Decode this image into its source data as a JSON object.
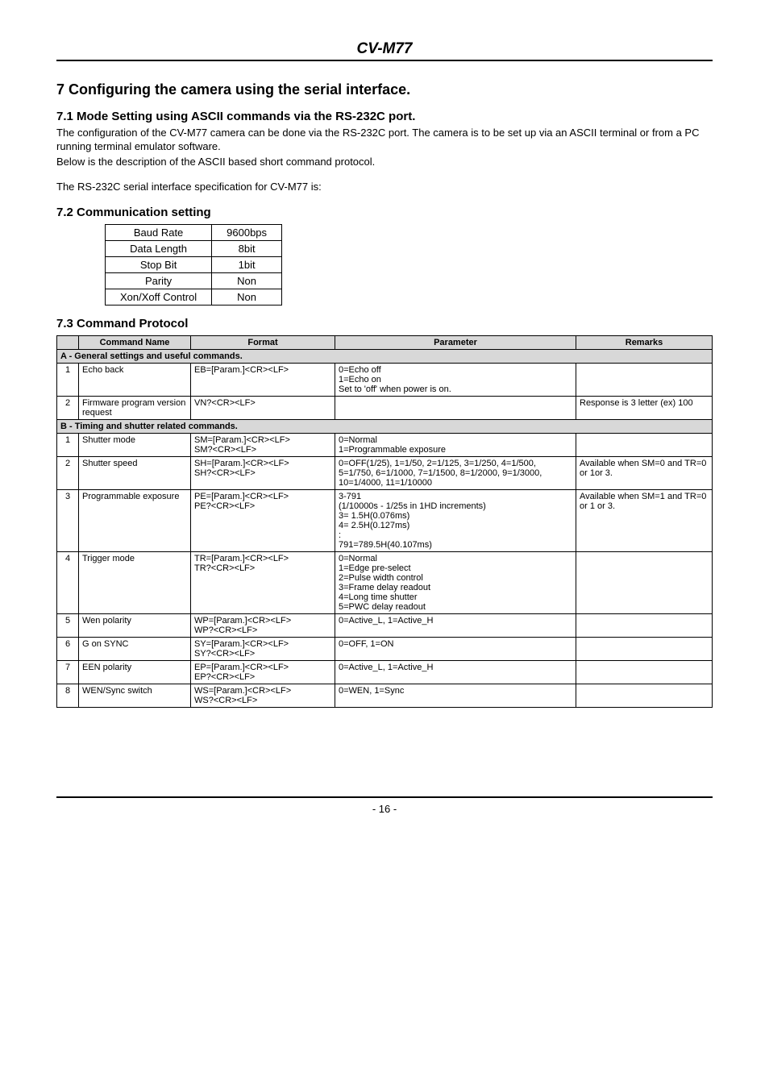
{
  "header": {
    "model": "CV-M77"
  },
  "section7": {
    "title": "7   Configuring the camera using the serial interface.",
    "s71": {
      "heading": "7.1   Mode Setting using ASCII commands via the RS-232C port.",
      "p1": "The configuration of the CV-M77 camera can be done via the RS-232C port.  The camera is to be set up via an ASCII terminal or from a PC running terminal emulator software.",
      "p2": "Below is the description of the ASCII based short command protocol.",
      "p3": "The RS-232C serial interface specification for CV-M77 is:"
    },
    "s72": {
      "heading": "7.2   Communication setting",
      "rows": [
        {
          "k": "Baud Rate",
          "v": "9600bps"
        },
        {
          "k": "Data Length",
          "v": "8bit"
        },
        {
          "k": "Stop Bit",
          "v": "1bit"
        },
        {
          "k": "Parity",
          "v": "Non"
        },
        {
          "k": "Xon/Xoff Control",
          "v": "Non"
        }
      ]
    },
    "s73": {
      "heading": "7.3   Command Protocol",
      "headers": {
        "name": "Command Name",
        "format": "Format",
        "param": "Parameter",
        "remarks": "Remarks"
      },
      "groupA": "A - General settings and useful commands.",
      "groupB": "B - Timing and shutter related commands.",
      "rowsA": [
        {
          "n": "1",
          "name": "Echo back",
          "format": "EB=[Param.]<CR><LF>",
          "param": "0=Echo off\n1=Echo on\nSet to 'off' when power is on.",
          "remarks": ""
        },
        {
          "n": "2",
          "name": "Firmware program version request",
          "format": "VN?<CR><LF>",
          "param": "",
          "remarks": "Response is 3 letter (ex) 100"
        }
      ],
      "rowsB": [
        {
          "n": "1",
          "name": "Shutter mode",
          "format": "SM=[Param.]<CR><LF>\nSM?<CR><LF>",
          "param": "0=Normal\n1=Programmable exposure",
          "remarks": ""
        },
        {
          "n": "2",
          "name": "Shutter speed",
          "format": "SH=[Param.]<CR><LF>\nSH?<CR><LF>",
          "param": "0=OFF(1/25), 1=1/50, 2=1/125, 3=1/250, 4=1/500, 5=1/750, 6=1/1000, 7=1/1500, 8=1/2000, 9=1/3000, 10=1/4000, 11=1/10000",
          "remarks": "Available when SM=0 and TR=0 or 1or 3."
        },
        {
          "n": "3",
          "name": "Programmable exposure",
          "format": "PE=[Param.]<CR><LF>\nPE?<CR><LF>",
          "param": "3-791\n(1/10000s - 1/25s in 1HD increments)\n  3=  1.5H(0.076ms)\n  4=  2.5H(0.127ms)\n  :\n791=789.5H(40.107ms)",
          "remarks": "Available when SM=1 and TR=0 or 1 or 3."
        },
        {
          "n": "4",
          "name": "Trigger mode",
          "format": "TR=[Param.]<CR><LF>\nTR?<CR><LF>",
          "param": "0=Normal\n1=Edge pre-select\n2=Pulse width control\n3=Frame delay readout\n4=Long time shutter\n5=PWC delay readout",
          "remarks": ""
        },
        {
          "n": "5",
          "name": "Wen polarity",
          "format": "WP=[Param.]<CR><LF>\nWP?<CR><LF>",
          "param": "0=Active_L, 1=Active_H",
          "remarks": ""
        },
        {
          "n": "6",
          "name": "G on SYNC",
          "format": "SY=[Param.]<CR><LF>\nSY?<CR><LF>",
          "param": "0=OFF, 1=ON",
          "remarks": ""
        },
        {
          "n": "7",
          "name": "EEN polarity",
          "format": "EP=[Param.]<CR><LF>\nEP?<CR><LF>",
          "param": "0=Active_L, 1=Active_H",
          "remarks": ""
        },
        {
          "n": "8",
          "name": "WEN/Sync switch",
          "format": "WS=[Param.]<CR><LF>\nWS?<CR><LF>",
          "param": "0=WEN, 1=Sync",
          "remarks": ""
        }
      ]
    }
  },
  "footer": {
    "page": "- 16 -"
  }
}
